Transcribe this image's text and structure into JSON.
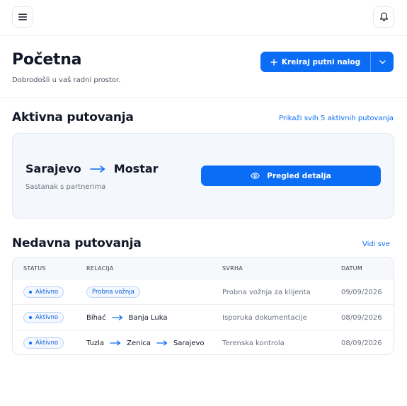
{
  "header": {
    "title": "Početna",
    "subtitle": "Dobrodošli u vaš radni prostor.",
    "create_label": "Kreiraj putni nalog"
  },
  "active_trips": {
    "title": "Aktivna putovanja",
    "link": "Prikaži svih 5 aktivnih putovanja",
    "card": {
      "from": "Sarajevo",
      "to": "Mostar",
      "purpose": "Sastanak s partnerima",
      "button_label": "Pregled detalja"
    }
  },
  "recent_trips": {
    "title": "Nedavna putovanja",
    "link": "Vidi sve",
    "columns": [
      "STATUS",
      "RELACIJA",
      "SVRHA",
      "DATUM"
    ],
    "rows": [
      {
        "status": "Aktivno",
        "relation": [
          "Probna vožnja"
        ],
        "purpose": "Probna vožnja za klijenta",
        "date": "09/09/2026"
      },
      {
        "status": "Aktivno",
        "relation": [
          "Bihać",
          "Banja Luka"
        ],
        "purpose": "Isporuka dokumentacije",
        "date": "08/09/2026"
      },
      {
        "status": "Aktivno",
        "relation": [
          "Tuzla",
          "Zenica",
          "Sarajevo"
        ],
        "purpose": "Terenska kontrola",
        "date": "08/09/2026"
      }
    ]
  },
  "icons": {
    "menu": "menu-icon",
    "bell": "bell-icon",
    "plus": "plus-icon",
    "chevron": "chevron-down-icon",
    "eye": "eye-icon",
    "arrow": "arrow-right-icon"
  },
  "colors": {
    "accent": "#0b6cf5",
    "card_bg": "#f4f7fc"
  }
}
